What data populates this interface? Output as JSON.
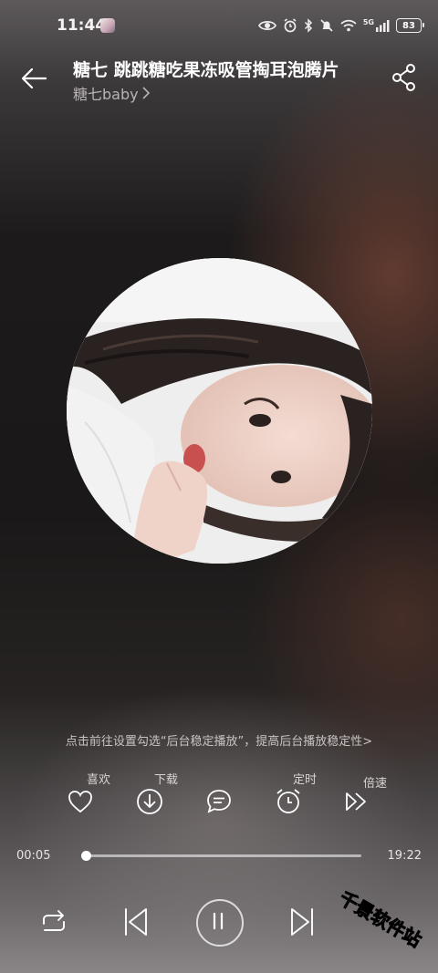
{
  "status_bar": {
    "time": "11:44",
    "battery": "83",
    "network": "5G"
  },
  "header": {
    "title": "糖七 跳跳糖吃果冻吸管掏耳泡腾片",
    "artist": "糖七baby",
    "artist_chevron": "›"
  },
  "tip": "点击前往设置勾选“后台稳定播放”，提高后台播放稳定性>",
  "actions": {
    "like": "喜欢",
    "download": "下载",
    "comment": "",
    "timer": "定时",
    "speed": "倍速"
  },
  "progress": {
    "current": "00:05",
    "total": "19:22",
    "fraction": 0.004
  },
  "watermark": "千景软件站",
  "colors": {
    "accent": "#ffffff",
    "muted_text": "#b9b4b4"
  }
}
